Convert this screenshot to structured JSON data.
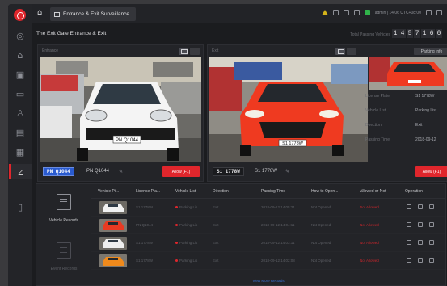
{
  "topbar": {
    "tab_label": "Entrance & Exit Surveillance",
    "user_text": "admin | 14:06 UTC+08:00"
  },
  "page": {
    "title": "The Exit Gate Entrance & Exit",
    "flow_label": "Total Passing Vehicles",
    "counter": [
      "1",
      "4",
      "5",
      "7",
      "1",
      "6",
      "0"
    ]
  },
  "panels": {
    "left": {
      "label": "Entrance",
      "plate": "PN Q1044",
      "plate_text": "PN Q1044",
      "button": "Allow (F1)"
    },
    "right": {
      "label": "Exit",
      "plate": "S1 1778W",
      "plate_text": "S1 1778W",
      "side_button": "Parking Info",
      "button": "Allow (F1)",
      "info": [
        {
          "k": "License Plate",
          "v": "S1 1778W"
        },
        {
          "k": "Vehicle List",
          "v": "Parking List"
        },
        {
          "k": "Direction",
          "v": "Exit"
        },
        {
          "k": "Passing Time",
          "v": "2018-09-12"
        }
      ]
    }
  },
  "cards": [
    {
      "label": "Vehicle Records"
    },
    {
      "label": "Event Records"
    }
  ],
  "table": {
    "headers": [
      "Vehicle Pi...",
      "License Pla...",
      "Vehicle List",
      "Direction",
      "Passing Time",
      "How to Open...",
      "Allowed or Not",
      "Operation"
    ],
    "rows": [
      {
        "plate": "S1 1778W",
        "list": "Parking Lis",
        "dir": "Exit",
        "time": "2018-09-12 14:05:21",
        "how": "Not Opened",
        "allowed": "Not Allowed",
        "car": "white"
      },
      {
        "plate": "PN Q1044",
        "list": "Parking Lis",
        "dir": "Exit",
        "time": "2018-09-12 14:04:11",
        "how": "Not Opened",
        "allowed": "Not Allowed",
        "car": "red"
      },
      {
        "plate": "S1 1778W",
        "list": "Parking Lis",
        "dir": "Exit",
        "time": "2018-09-12 14:03:11",
        "how": "Not Opened",
        "allowed": "Not Allowed",
        "car": "white"
      },
      {
        "plate": "S1 1778W",
        "list": "Parking Lis",
        "dir": "Exit",
        "time": "2018-09-12 14:02:08",
        "how": "Not Opened",
        "allowed": "Not Allowed",
        "car": "orange"
      }
    ],
    "more_label": "View More Records"
  },
  "colors": {
    "accent": "#e0262c",
    "background": "#1b1c1f",
    "panel": "#232428"
  },
  "icons": [
    "home-icon",
    "warning-icon",
    "bell-icon",
    "settings-icon",
    "status-icon",
    "camera-icon",
    "map-icon",
    "person-icon",
    "grid-icon",
    "barrier-icon",
    "door-icon"
  ]
}
